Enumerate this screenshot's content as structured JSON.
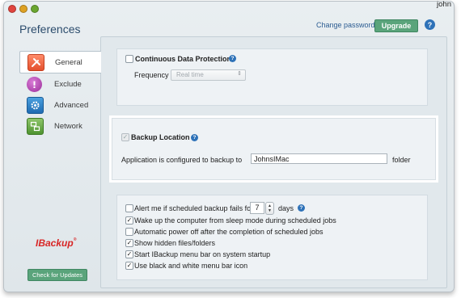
{
  "window": {
    "user": "john",
    "title": "Preferences",
    "change_password": "Change password",
    "upgrade": "Upgrade",
    "help_glyph": "?"
  },
  "sidebar": {
    "items": [
      {
        "label": "General",
        "icon": "tools-icon",
        "active": true
      },
      {
        "label": "Exclude",
        "icon": "exclamation-icon",
        "active": false
      },
      {
        "label": "Advanced",
        "icon": "gear-icon",
        "active": false
      },
      {
        "label": "Network",
        "icon": "network-icon",
        "active": false
      }
    ],
    "logo": "IBackup",
    "logo_mark": "®",
    "check_updates": "Check for Updates"
  },
  "cdp": {
    "label": "Continuous Data Protection",
    "checked": false,
    "frequency_label": "Frequency",
    "frequency_value": "Real time"
  },
  "backup_location": {
    "label": "Backup Location",
    "checked": true,
    "sentence_prefix": "Application is configured to backup to",
    "folder_value": "JohnsIMac",
    "sentence_suffix": "folder"
  },
  "options": {
    "alert_prefix": "Alert me if scheduled backup fails for",
    "alert_days": "7",
    "alert_suffix": "days",
    "alert_checked": false,
    "items": [
      {
        "label": "Wake up the computer from sleep mode during scheduled jobs",
        "checked": true
      },
      {
        "label": "Automatic power off after the completion of scheduled jobs",
        "checked": false
      },
      {
        "label": "Show hidden files/folders",
        "checked": true
      },
      {
        "label": "Start IBackup menu bar on system startup",
        "checked": true
      },
      {
        "label": "Use black and white menu bar icon",
        "checked": true
      }
    ]
  },
  "colors": {
    "accent_green": "#5aa47b",
    "link_blue": "#2b5c91",
    "logo_red": "#d82626"
  }
}
